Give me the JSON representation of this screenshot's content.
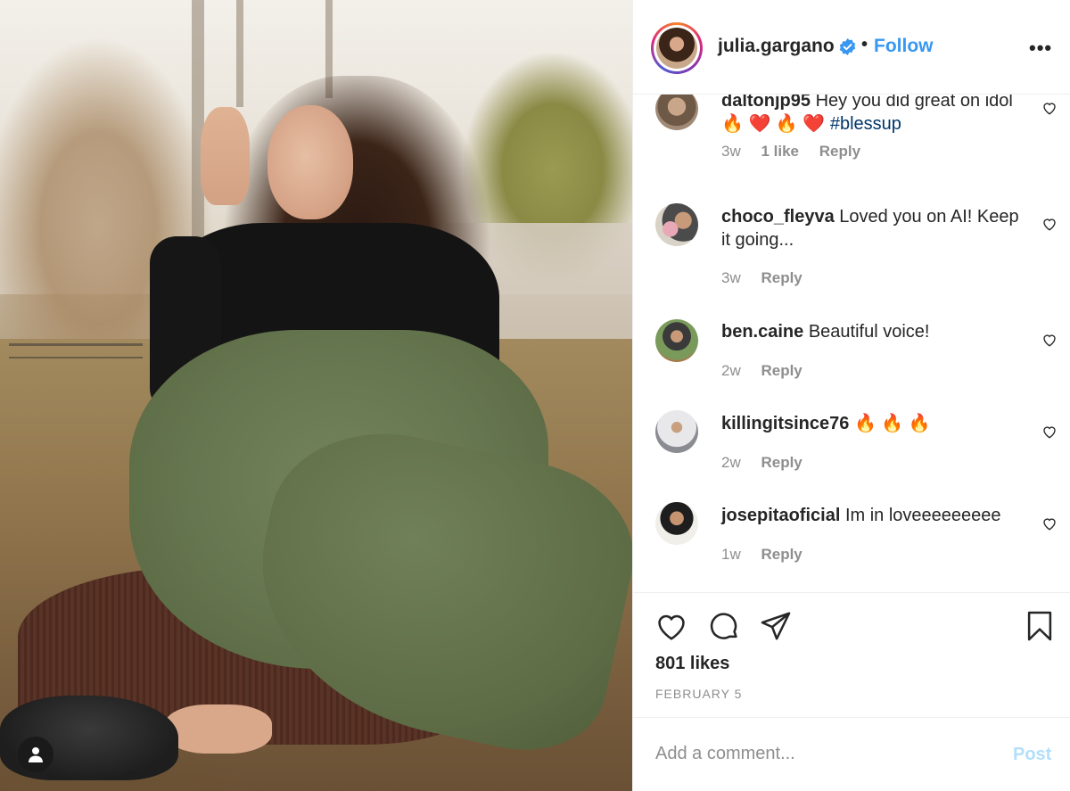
{
  "post": {
    "username": "julia.gargano",
    "verified": true,
    "separator": "•",
    "follow_label": "Follow",
    "more_icon": "more-options-icon",
    "likes": "801 likes",
    "date": "FEBRUARY 5"
  },
  "comments": [
    {
      "user": "daltonjp95",
      "text": "Hey you did great on idol🔥 ❤️ 🔥 ❤️ ",
      "hashtag": "#blessup",
      "time": "3w",
      "likes": "1 like",
      "reply": "Reply"
    },
    {
      "user": "choco_fleyva",
      "text": "Loved you on AI! Keep it going...",
      "time": "3w",
      "reply": "Reply"
    },
    {
      "user": "ben.caine",
      "text": "Beautiful voice!",
      "time": "2w",
      "reply": "Reply"
    },
    {
      "user": "killingitsince76",
      "text": "🔥 🔥 🔥",
      "time": "2w",
      "reply": "Reply"
    },
    {
      "user": "josepitaoficial",
      "text": "Im in loveeeeeeeee",
      "time": "1w",
      "reply": "Reply"
    }
  ],
  "comment_box": {
    "placeholder": "Add a comment...",
    "post_label": "Post"
  },
  "colors": {
    "link_blue": "#3897f0",
    "post_disabled": "#b2dffc",
    "text": "#262626",
    "muted": "#8e8e8e"
  }
}
